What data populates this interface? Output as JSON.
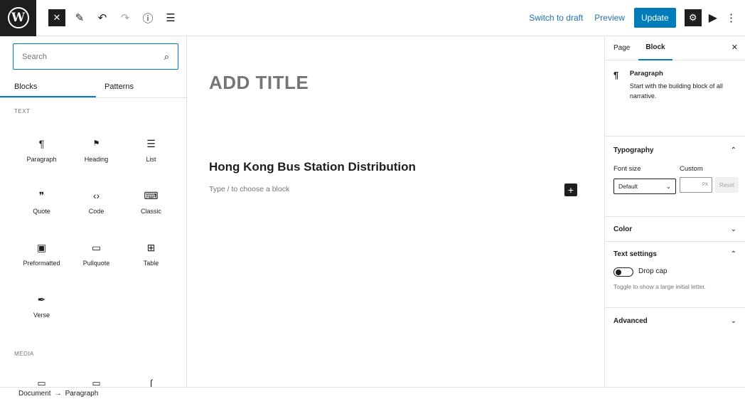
{
  "toolbar": {
    "logo": "W",
    "close_icon": "✕",
    "tools_icon": "✎",
    "undo_icon": "↶",
    "redo_icon": "↷",
    "info_icon": "ⓘ",
    "list_view_icon": "☰",
    "switch_to_draft": "Switch to draft",
    "preview": "Preview",
    "update": "Update",
    "settings_icon": "⚙",
    "plugin_icon": "▶",
    "more_icon": "⋮"
  },
  "inserter": {
    "search_placeholder": "Search",
    "search_icon": "⌕",
    "tabs": [
      {
        "label": "Blocks"
      },
      {
        "label": "Patterns"
      }
    ],
    "text_category": "TEXT",
    "text_blocks": [
      {
        "label": "Paragraph",
        "icon": "¶"
      },
      {
        "label": "Heading",
        "icon": "🔖"
      },
      {
        "label": "List",
        "icon": "☰"
      },
      {
        "label": "Quote",
        "icon": "❞"
      },
      {
        "label": "Code",
        "icon": "‹›"
      },
      {
        "label": "Classic",
        "icon": "⌨"
      },
      {
        "label": "Preformatted",
        "icon": "▣"
      },
      {
        "label": "Pullquote",
        "icon": "▭"
      },
      {
        "label": "Table",
        "icon": "⊞"
      },
      {
        "label": "Verse",
        "icon": "✒"
      }
    ],
    "media_category": "MEDIA",
    "media_icons": [
      "▭",
      "▭",
      "∫"
    ]
  },
  "canvas": {
    "title": "ADD TITLE",
    "heading": "Hong Kong Bus Station Distribution",
    "placeholder": "Type / to choose a block",
    "add_icon": "+"
  },
  "sidebar": {
    "tabs": [
      {
        "label": "Page"
      },
      {
        "label": "Block"
      }
    ],
    "close_icon": "✕",
    "block_icon": "¶",
    "block_title": "Paragraph",
    "block_desc": "Start with the building block of all narrative.",
    "typography": "Typography",
    "font_size_label": "Font size",
    "custom_label": "Custom",
    "font_size_value": "Default",
    "custom_unit": "PX",
    "reset": "Reset",
    "color": "Color",
    "text_settings": "Text settings",
    "drop_cap": "Drop cap",
    "drop_cap_help": "Toggle to show a large initial letter.",
    "advanced": "Advanced",
    "chevron_up": "⌃",
    "chevron_down": "⌄"
  },
  "footer": {
    "crumb1": "Document",
    "separator": "→",
    "crumb2": "Paragraph"
  }
}
